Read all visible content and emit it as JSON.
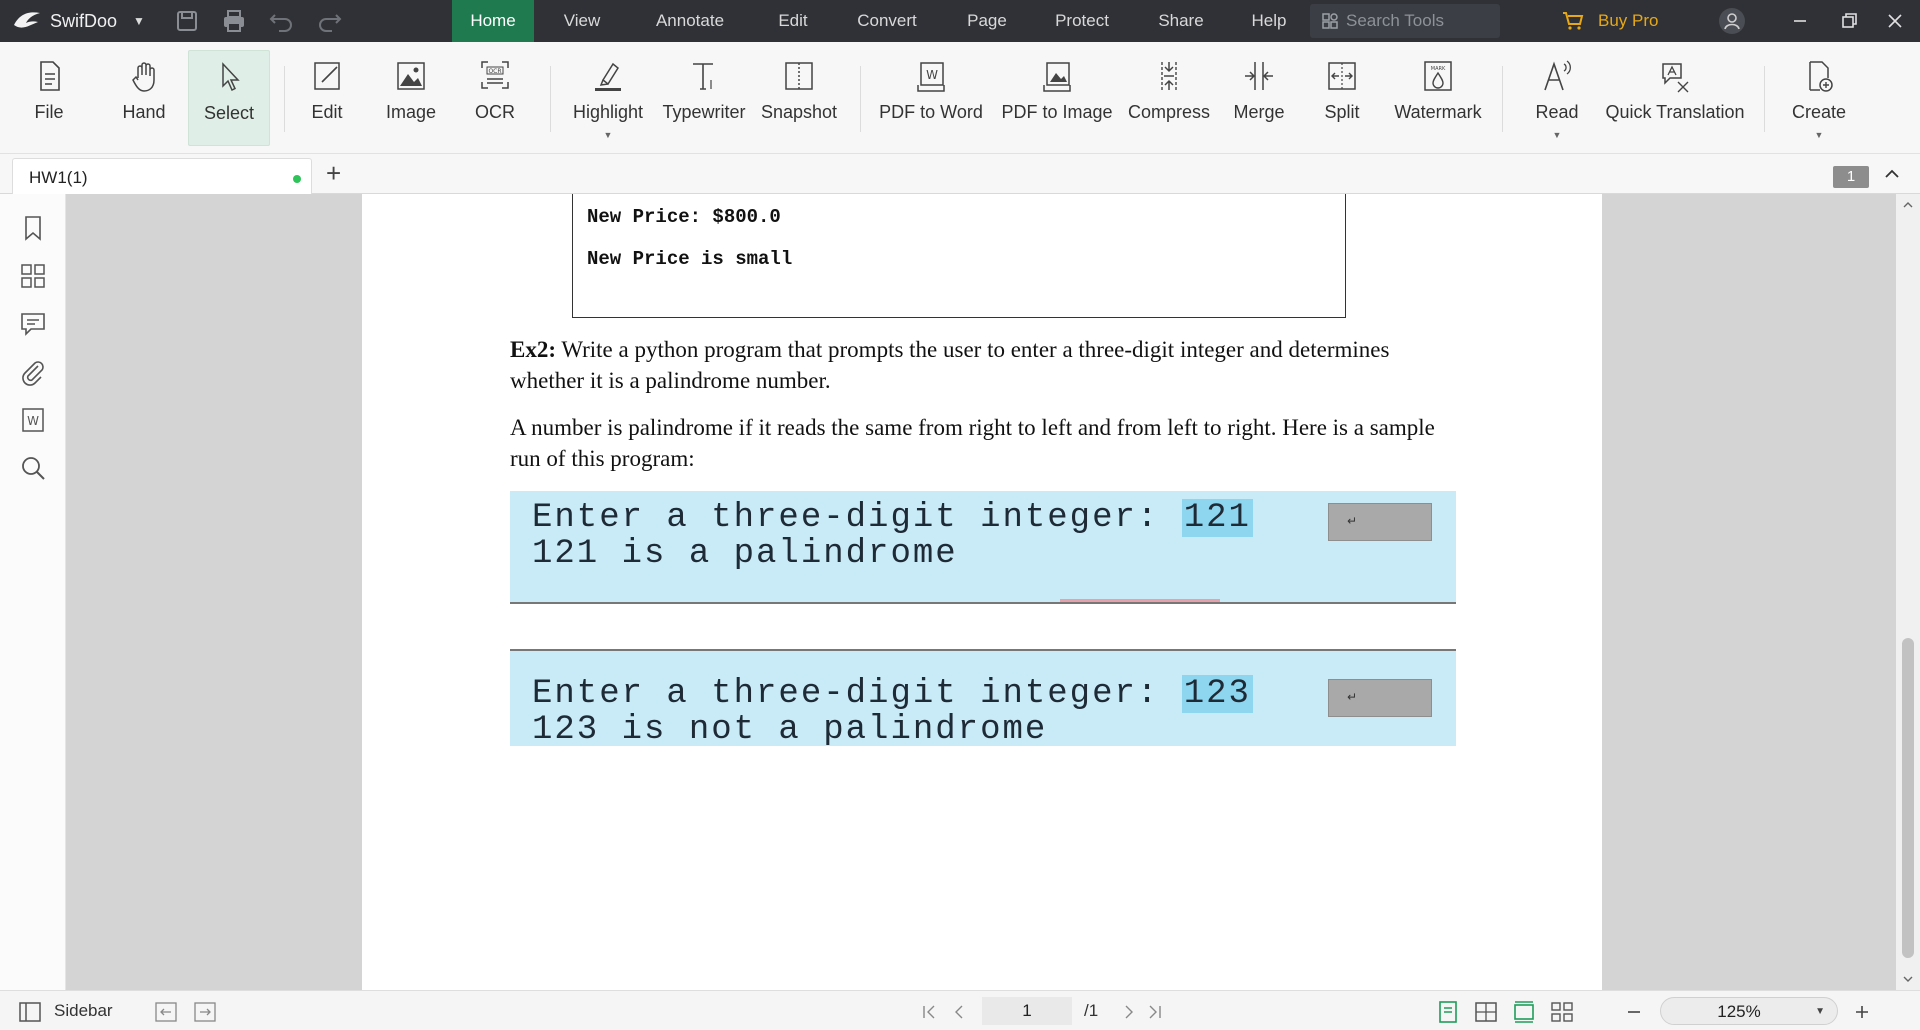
{
  "app": {
    "name": "SwifDoo",
    "menu": [
      "Home",
      "View",
      "Annotate",
      "Edit",
      "Convert",
      "Page",
      "Protect",
      "Share",
      "Help"
    ],
    "active_menu": "Home",
    "search_placeholder": "Search Tools",
    "buy_pro": "Buy Pro"
  },
  "ribbon": {
    "tools": [
      "File",
      "Hand",
      "Select",
      "Edit",
      "Image",
      "OCR",
      "Highlight",
      "Typewriter",
      "Snapshot",
      "PDF to Word",
      "PDF to Image",
      "Compress",
      "Merge",
      "Split",
      "Watermark",
      "Read",
      "Quick Translation",
      "Create"
    ],
    "selected_tool": "Select"
  },
  "tabs": {
    "document": "HW1(1)",
    "page_badge": "1"
  },
  "document": {
    "code_lines": [
      "New Price: $800.0",
      "New Price is small"
    ],
    "ex2_label": "Ex2:",
    "ex2_text": " Write a python program that prompts the user to enter a three-digit integer and determines whether it is a palindrome number.",
    "para2": "A number is palindrome if it reads the same from right to left and from left to right. Here is a sample run of this program:",
    "run1": {
      "prompt": "Enter a three-digit integer: ",
      "input": "121",
      "enter_key": "↵",
      "result": "121 is a palindrome"
    },
    "run2": {
      "prompt": "Enter a three-digit integer: ",
      "input": "123",
      "enter_key": "↵",
      "result": "123 is not a palindrome"
    }
  },
  "statusbar": {
    "sidebar_label": "Sidebar",
    "current_page": "1",
    "total_pages": "/1",
    "zoom": "125%"
  },
  "colors": {
    "titlebar": "#2f3136",
    "active_menu": "#1f7a4f",
    "buy_pro": "#e6a817",
    "terminal_bg": "#c9ebf7",
    "workspace": "#d4d4d4"
  }
}
